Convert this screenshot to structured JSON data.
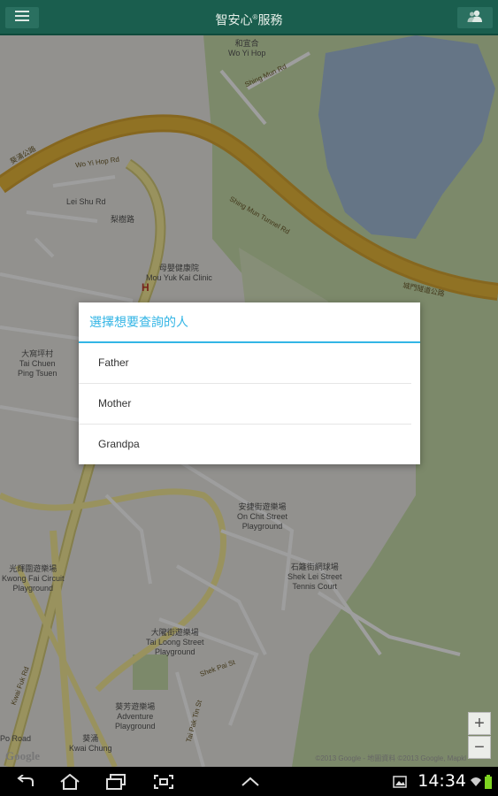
{
  "app": {
    "title": "智安心",
    "title_mark": "®",
    "title_suffix": "服務"
  },
  "action_bar": {
    "menu_icon": "hamburger-icon",
    "contacts_icon": "people-icon",
    "background": "#1a5e4e"
  },
  "dialog": {
    "title": "選擇想要查詢的人",
    "accent": "#33b5e5",
    "items": [
      {
        "label": "Father"
      },
      {
        "label": "Mother"
      },
      {
        "label": "Grandpa"
      }
    ]
  },
  "map": {
    "labels": {
      "wo_yi_hop_zh": "和宜合",
      "wo_yi_hop_en": "Wo Yi Hop",
      "shing_mun_rd": "Shing Mun Rd",
      "wo_yi_hop_rd": "Wo Yi Hop Rd",
      "lei_shu_rd": "Lei Shu Rd",
      "lei_shu_rd_zh": "梨樹路",
      "shing_mun_tunnel": "Shing Mun Tunnel Rd",
      "shing_mun_tunnel_zh": "城門隧道公路",
      "kwai_chung_rd_zh": "葵涌公路",
      "mou_yuk_zh": "母嬰健康院",
      "mou_yuk_en": "Mou Yuk Kai Clinic",
      "tai_chuen_zh": "大窩坪村",
      "tai_chuen_en": "Tai Chuen",
      "tai_chuen_en2": "Ping Tsuen",
      "on_chit_zh": "安捷街遊樂場",
      "on_chit_en": "On Chit Street",
      "on_chit_en2": "Playground",
      "shek_lei_zh": "石籬街網球場",
      "shek_lei_en": "Shek Lei Street",
      "shek_lei_en2": "Tennis Court",
      "kwong_fai_zh": "光輝圍遊樂場",
      "kwong_fai_en": "Kwong Fai Circuit",
      "kwong_fai_en2": "Playground",
      "tai_loong_zh": "大隴街遊樂場",
      "tai_loong_en": "Tai Loong Street",
      "tai_loong_en2": "Playground",
      "adventure_zh": "葵芳遊樂場",
      "adventure_en": "Adventure",
      "adventure_en2": "Playground",
      "kwai_chung_zh": "葵涌",
      "kwai_chung_en": "Kwai Chung",
      "tai_pak_rd": "Tai Pak Tin St",
      "shek_pai": "Shek Pai St",
      "kwai_fuk_rd": "Kwai Fuk Rd",
      "po_road": "Po Road"
    },
    "google": "Google",
    "copyright": "©2013 Google - 地圖資料 ©2013 Google, Mapkl",
    "zoom_in": "+",
    "zoom_out": "−",
    "colors": {
      "land": "#ecebe5",
      "park": "#c9deac",
      "water": "#a4bdd9",
      "highway": "#e8b83b",
      "road": "#f7ec98"
    }
  },
  "status": {
    "time": "14:34"
  }
}
